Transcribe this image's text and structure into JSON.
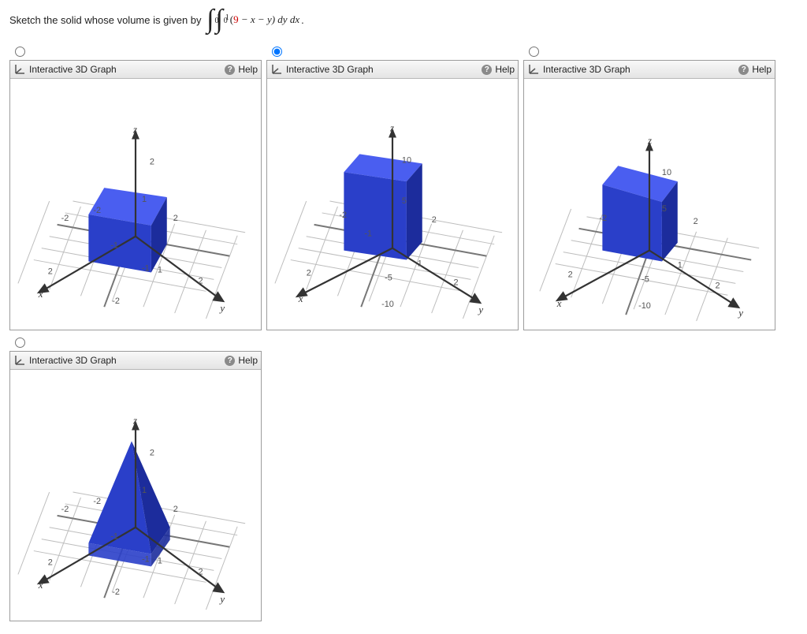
{
  "prompt": {
    "leading": "Sketch the solid whose volume is given by ",
    "outer_upper": "1",
    "outer_lower": "0",
    "inner_upper": "1",
    "inner_lower": "0",
    "coef": "9",
    "integrand_rest": " − x − y) dy dx",
    "period": "."
  },
  "panel": {
    "title": "Interactive 3D Graph",
    "help": "Help"
  },
  "options": {
    "a": {
      "z_label": "z",
      "x_label": "x",
      "y_label": "y",
      "z_tick_top": "2",
      "z_tick_1": "1",
      "z_tick_neg1": "-1",
      "y_tick_2": "2",
      "y_tick_neg2": "-2",
      "y_tick_1": "1",
      "y_tick_neg1": "-1",
      "x_tick_neg2": "-2",
      "x_tick_2": "2",
      "x_tick_neg1": "-1",
      "x_tick_1": "1"
    },
    "b": {
      "z_label": "z",
      "x_label": "x",
      "y_label": "y",
      "z_tick_10": "10",
      "z_tick_5": "5",
      "z_tick_neg5": "-5",
      "z_tick_neg10": "-10",
      "y_tick_2": "2",
      "y_tick_1": "1",
      "x_tick_2": "2",
      "x_tick_neg1": "-1",
      "x_tick_neg2": "-2",
      "x_tick_1": "1"
    },
    "c": {
      "z_label": "z",
      "x_label": "x",
      "y_label": "y",
      "z_tick_10": "10",
      "z_tick_5": "5",
      "z_tick_neg5": "-5",
      "z_tick_neg10": "-10",
      "y_tick_2": "2",
      "y_tick_1": "1",
      "x_tick_2": "2",
      "x_tick_neg2": "-2"
    },
    "d": {
      "z_label": "z",
      "x_label": "x",
      "y_label": "y",
      "z_tick_top": "2",
      "z_tick_1": "1",
      "z_tick_neg1": "-1",
      "x_tick_neg2": "-2",
      "y_tick_2": "2",
      "x_tick_2": "2",
      "y_tick_neg2": "-2",
      "y_tick_1": "1",
      "y_tick_neg1": "-1"
    }
  },
  "selected": "b",
  "chart_data": [
    {
      "option": "a",
      "type": "3d-solid",
      "description": "Cube-like solid over [-1,1]x[-1,1] with flat top at z≈1",
      "x_range": [
        -1,
        1
      ],
      "y_range": [
        -1,
        1
      ],
      "z_range": [
        -1,
        1
      ],
      "axes": {
        "x": [
          -2,
          2
        ],
        "y": [
          -2,
          2
        ],
        "z": [
          -1,
          2
        ]
      }
    },
    {
      "option": "b",
      "type": "3d-solid",
      "description": "Tall rectangular prism over [0,1]x[0,1] reaching nearly z=9 (approx 10 on shown scale)",
      "x_range": [
        -1,
        1
      ],
      "y_range": [
        -1,
        1
      ],
      "z_range": [
        0,
        9
      ],
      "axes": {
        "x": [
          -2,
          2
        ],
        "y": [
          -2,
          2
        ],
        "z": [
          -10,
          10
        ]
      }
    },
    {
      "option": "c",
      "type": "3d-solid",
      "description": "Rectangular prism over [0,1]x[0,1] topped by slanted plane z=9-x-y; top tilts down toward +x,+y",
      "x_range": [
        0,
        1
      ],
      "y_range": [
        0,
        1
      ],
      "z_range": [
        0,
        9
      ],
      "axes": {
        "x": [
          -2,
          2
        ],
        "y": [
          -2,
          2
        ],
        "z": [
          -10,
          10
        ]
      }
    },
    {
      "option": "d",
      "type": "3d-solid",
      "description": "Pyramid-like solid over [-1,1]x[-1,1] with apex near z=2",
      "x_range": [
        -1,
        1
      ],
      "y_range": [
        -1,
        1
      ],
      "z_range": [
        -1,
        2
      ],
      "axes": {
        "x": [
          -2,
          2
        ],
        "y": [
          -2,
          2
        ],
        "z": [
          -1,
          2
        ]
      }
    }
  ]
}
